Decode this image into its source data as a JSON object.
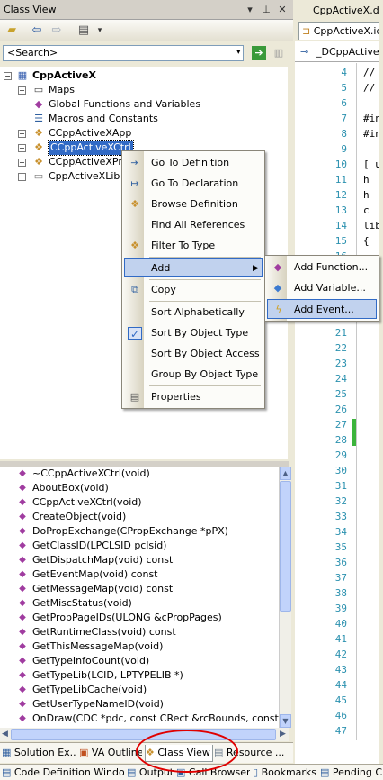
{
  "classview": {
    "title": "Class View",
    "search_placeholder": "<Search>",
    "tree": {
      "root": "CppActiveX",
      "items": [
        "Maps",
        "Global Functions and Variables",
        "Macros and Constants",
        "CCppActiveXApp",
        "CCppActiveXCtrl",
        "CCppActiveXPro",
        "CppActiveXLib"
      ]
    },
    "members": [
      "~CCppActiveXCtrl(void)",
      "AboutBox(void)",
      "CCppActiveXCtrl(void)",
      "CreateObject(void)",
      "DoPropExchange(CPropExchange *pPX)",
      "GetClassID(LPCLSID pclsid)",
      "GetDispatchMap(void) const",
      "GetEventMap(void) const",
      "GetMessageMap(void) const",
      "GetMiscStatus(void)",
      "GetPropPageIDs(ULONG &cPropPages)",
      "GetRuntimeClass(void) const",
      "GetThisMessageMap(void)",
      "GetTypeInfoCount(void)",
      "GetTypeLib(LCID, LPTYPELIB *)",
      "GetTypeLibCache(void)",
      "GetUserTypeNameID(void)",
      "OnDraw(CDC *pdc, const CRect &rcBounds, const CRec"
    ],
    "tabs": [
      "Solution Ex...",
      "VA Outline",
      "Class View",
      "Resource ..."
    ]
  },
  "bottom_tabs": [
    "Code Definition Window",
    "Output",
    "Call Browser",
    "Bookmarks",
    "Pending Ch"
  ],
  "context_menu": {
    "items": [
      "Go To Definition",
      "Go To Declaration",
      "Browse Definition",
      "Find All References",
      "Filter To Type",
      "Add",
      "Copy",
      "Sort Alphabetically",
      "Sort By Object Type",
      "Sort By Object Access",
      "Group By Object Type",
      "Properties"
    ],
    "submenu": [
      "Add Function...",
      "Add Variable...",
      "Add Event..."
    ]
  },
  "editor": {
    "tab1": "CppActiveX.def",
    "tab2": "CppActiveX.idl",
    "combo": "_DCppActiveX",
    "lines": [
      {
        "n": "4",
        "code": "//"
      },
      {
        "n": "5",
        "code": "//"
      },
      {
        "n": "6",
        "code": ""
      },
      {
        "n": "7",
        "code": "#in"
      },
      {
        "n": "8",
        "code": "#in"
      },
      {
        "n": "9",
        "code": ""
      },
      {
        "n": "10",
        "code": "[ u"
      },
      {
        "n": "11",
        "code": "  h"
      },
      {
        "n": "12",
        "code": "  h"
      },
      {
        "n": "13",
        "code": "  c"
      },
      {
        "n": "14",
        "code": "lib"
      },
      {
        "n": "15",
        "code": "{"
      },
      {
        "n": "16",
        "code": ""
      },
      {
        "n": "17",
        "code": ""
      },
      {
        "n": "18",
        "code": ""
      },
      {
        "n": "19",
        "code": ""
      },
      {
        "n": "20",
        "code": ""
      },
      {
        "n": "21",
        "code": ""
      },
      {
        "n": "22",
        "code": ""
      },
      {
        "n": "23",
        "code": ""
      },
      {
        "n": "24",
        "code": ""
      },
      {
        "n": "25",
        "code": ""
      },
      {
        "n": "26",
        "code": ""
      },
      {
        "n": "27",
        "code": ""
      },
      {
        "n": "28",
        "code": ""
      },
      {
        "n": "29",
        "code": ""
      },
      {
        "n": "30",
        "code": ""
      },
      {
        "n": "31",
        "code": ""
      },
      {
        "n": "32",
        "code": ""
      },
      {
        "n": "33",
        "code": ""
      },
      {
        "n": "34",
        "code": ""
      },
      {
        "n": "35",
        "code": ""
      },
      {
        "n": "36",
        "code": ""
      },
      {
        "n": "37",
        "code": ""
      },
      {
        "n": "38",
        "code": ""
      },
      {
        "n": "39",
        "code": ""
      },
      {
        "n": "40",
        "code": ""
      },
      {
        "n": "41",
        "code": ""
      },
      {
        "n": "42",
        "code": ""
      },
      {
        "n": "43",
        "code": ""
      },
      {
        "n": "44",
        "code": ""
      },
      {
        "n": "45",
        "code": ""
      },
      {
        "n": "46",
        "code": ""
      },
      {
        "n": "47",
        "code": ""
      }
    ]
  },
  "colors": {
    "selection": "#316ac5",
    "highlight": "#c1d2ee",
    "line_numbers": "#2b91af",
    "annotation_circle": "#e00000"
  }
}
